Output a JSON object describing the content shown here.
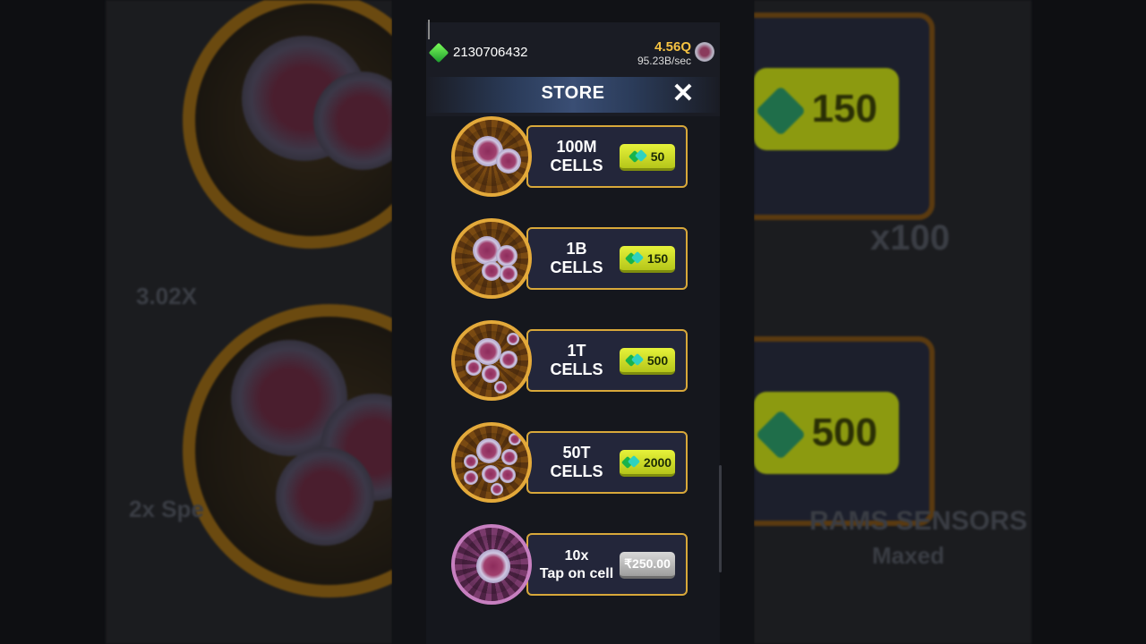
{
  "hud": {
    "gems": "2130706432",
    "cells_total": "4.56Q",
    "cells_rate": "95.23B/sec"
  },
  "store": {
    "title": "STORE",
    "close_symbol": "✕",
    "items": [
      {
        "line1": "100M",
        "line2": "CELLS",
        "price": "50",
        "currency": "gem-icon"
      },
      {
        "line1": "1B",
        "line2": "CELLS",
        "price": "150",
        "currency": "gem-icon"
      },
      {
        "line1": "1T",
        "line2": "CELLS",
        "price": "500",
        "currency": "gem-icon"
      },
      {
        "line1": "50T",
        "line2": "CELLS",
        "price": "2000",
        "currency": "gem-icon"
      },
      {
        "line1": "10x",
        "line2": "Tap on cell",
        "price": "₹250.00",
        "currency": "none"
      }
    ]
  },
  "background_text": {
    "right_top_price": "150",
    "right_bottom_price": "500",
    "left_multiplier": "3.02X",
    "left_speed": "2x Spe",
    "right_x100": "x100",
    "right_upgrade": "RAMS SENSORS",
    "right_maxed": "Maxed"
  },
  "colors": {
    "gold": "#f5c242",
    "card_border": "#d8a83a",
    "price_green": "#c7d826",
    "store_bar": "#3a4e74"
  }
}
